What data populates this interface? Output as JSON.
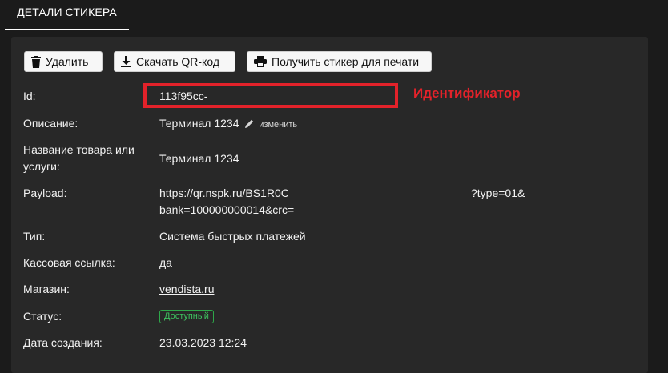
{
  "tab": {
    "label": "ДЕТАЛИ СТИКЕРА"
  },
  "toolbar": {
    "delete_label": "Удалить",
    "download_qr_label": "Скачать QR-код",
    "print_sticker_label": "Получить стикер для печати"
  },
  "details": {
    "id_label": "Id:",
    "id_value": "113f95cc-",
    "description_label": "Описание:",
    "description_value": "Терминал 1234",
    "edit_label": "изменить",
    "product_label_line1": "Название товара или",
    "product_label_line2": "услуги:",
    "product_value": "Терминал 1234",
    "payload_label": "Payload:",
    "payload_value_part1": "https://qr.nspk.ru/BS1R0C",
    "payload_value_part2": "?type=01&",
    "payload_value_line2": "bank=100000000014&crc=",
    "type_label": "Тип:",
    "type_value": "Система быстрых платежей",
    "cash_link_label": "Кассовая ссылка:",
    "cash_link_value": "да",
    "shop_label": "Магазин:",
    "shop_value": "vendista.ru",
    "status_label": "Статус:",
    "status_value": "Доступный",
    "created_label": "Дата создания:",
    "created_value": "23.03.2023 12:24"
  },
  "annotation": {
    "text": "Идентификатор"
  },
  "colors": {
    "accent_red": "#e3222a",
    "status_green": "#3ec25f",
    "panel": "#282828",
    "background": "#1b1b1b"
  },
  "icons": {
    "delete": "trash-icon",
    "download": "download-icon",
    "print": "printer-icon",
    "edit": "pencil-icon"
  }
}
